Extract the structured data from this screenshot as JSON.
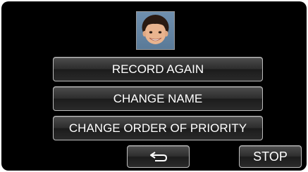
{
  "face": {
    "icon": "face-photo"
  },
  "menu": {
    "record_again": "RECORD AGAIN",
    "change_name": "CHANGE NAME",
    "change_order": "CHANGE ORDER OF PRIORITY"
  },
  "footer": {
    "back_icon": "return-arrow-icon",
    "stop_label": "STOP"
  },
  "colors": {
    "background": "#000000",
    "button_border": "#bdbdbd",
    "button_text": "#ffffff"
  }
}
